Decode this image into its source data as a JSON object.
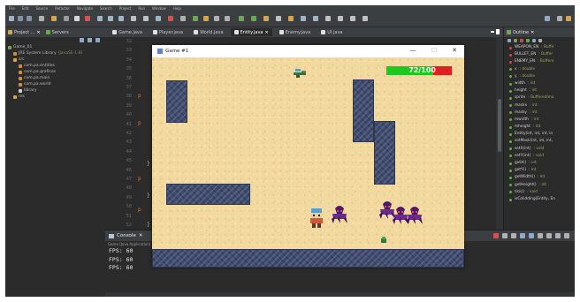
{
  "menu": [
    "File",
    "Edit",
    "Source",
    "Refactor",
    "Navigate",
    "Search",
    "Project",
    "Run",
    "Window",
    "Help"
  ],
  "explorer": {
    "tabs": [
      {
        "label": "Project ...",
        "close": "✕"
      },
      {
        "label": "Servers"
      }
    ],
    "tree": [
      {
        "label": "Game_01",
        "depth": 0,
        "color": "#6aa84f"
      },
      {
        "label": "JRE System Library",
        "extra": "[JavaSE-1.8]",
        "depth": 1,
        "color": "#c98f3e"
      },
      {
        "label": "src",
        "depth": 1,
        "color": "#d9a441"
      },
      {
        "label": "com.pa.entities",
        "depth": 2,
        "color": "#c98f3e"
      },
      {
        "label": "com.pa.graficos",
        "depth": 2,
        "color": "#c98f3e"
      },
      {
        "label": "com.pa.main",
        "depth": 2,
        "color": "#c98f3e"
      },
      {
        "label": "com.pa.world",
        "depth": 2,
        "color": "#c98f3e"
      },
      {
        "label": "library",
        "depth": 2,
        "color": "#d0d0d0"
      },
      {
        "label": "res",
        "depth": 1,
        "color": "#d9a441"
      }
    ]
  },
  "editor": {
    "tabs": [
      {
        "label": "Game.java",
        "active": false
      },
      {
        "label": "Player.java",
        "active": false
      },
      {
        "label": "World.java",
        "active": false
      },
      {
        "label": "Entity.java",
        "active": true,
        "close": "✕"
      },
      {
        "label": "Enemy.java",
        "active": false
      },
      {
        "label": "UI.java",
        "active": false
      }
    ],
    "line_numbers": [
      "32",
      "33",
      "34",
      "35",
      "36",
      "37",
      "38",
      "39",
      "40",
      "41",
      "42",
      "43",
      "44",
      "45",
      "46",
      "47",
      "48",
      "49",
      "50",
      "51",
      "52"
    ],
    "braces": [
      "}",
      "}",
      "}"
    ],
    "code_fragments": [
      "p",
      "p",
      "p",
      "p"
    ]
  },
  "outline": {
    "title": "Outline",
    "close": "✕",
    "items": [
      {
        "name": "WEAPON_EN",
        "type": ": Buffe",
        "dot": "#d64545"
      },
      {
        "name": "BULLET_EN",
        "type": ": Buffer",
        "dot": "#d64545"
      },
      {
        "name": "ENEMY_EN",
        "type": ": Buffere",
        "dot": "#d64545"
      },
      {
        "name": "x",
        "type": ": double",
        "dot": "#6aa84f"
      },
      {
        "name": "y",
        "type": ": double",
        "dot": "#6aa84f"
      },
      {
        "name": "width",
        "type": ": int",
        "dot": "#6aa84f"
      },
      {
        "name": "height",
        "type": ": int",
        "dot": "#6aa84f"
      },
      {
        "name": "sprite",
        "type": ": BufferedIma",
        "dot": "#6aa84f"
      },
      {
        "name": "maskx",
        "type": ": int",
        "dot": "#6aa84f"
      },
      {
        "name": "masky",
        "type": ": int",
        "dot": "#6aa84f"
      },
      {
        "name": "mwidth",
        "type": ": int",
        "dot": "#6aa84f"
      },
      {
        "name": "mheight",
        "type": ": int",
        "dot": "#6aa84f"
      },
      {
        "name": "Entity(int, int, int, in",
        "type": "",
        "dot": "#6aa84f"
      },
      {
        "name": "setMask(int, int, int,",
        "type": "",
        "dot": "#6aa84f"
      },
      {
        "name": "setX(int)",
        "type": ": void",
        "dot": "#6aa84f"
      },
      {
        "name": "setY(int)",
        "type": ": void",
        "dot": "#6aa84f"
      },
      {
        "name": "getX()",
        "type": ": int",
        "dot": "#6aa84f"
      },
      {
        "name": "getY()",
        "type": ": int",
        "dot": "#6aa84f"
      },
      {
        "name": "getWidth()",
        "type": ": int",
        "dot": "#6aa84f"
      },
      {
        "name": "getHeight()",
        "type": ": int",
        "dot": "#6aa84f"
      },
      {
        "name": "tick()",
        "type": ": void",
        "dot": "#6aa84f"
      },
      {
        "name": "isColidding(Entity, En",
        "type": "",
        "dot": "#6aa84f"
      }
    ]
  },
  "console": {
    "title": "Console",
    "close": "✕",
    "subtitle": "Game (Java Application)",
    "lines": [
      "FPS: 60",
      "FPS: 60",
      "FPS: 60"
    ]
  },
  "game": {
    "title": "Game #1",
    "controls": {
      "minimize": "—",
      "maximize": "☐",
      "close": "✕"
    },
    "hp_text": "72/100",
    "hp_fraction": 0.72,
    "colors": {
      "hp_full": "#1ec81e",
      "hp_empty": "#e02020",
      "sand": "#f2d9a0",
      "rock": "#3e4a6d"
    }
  }
}
